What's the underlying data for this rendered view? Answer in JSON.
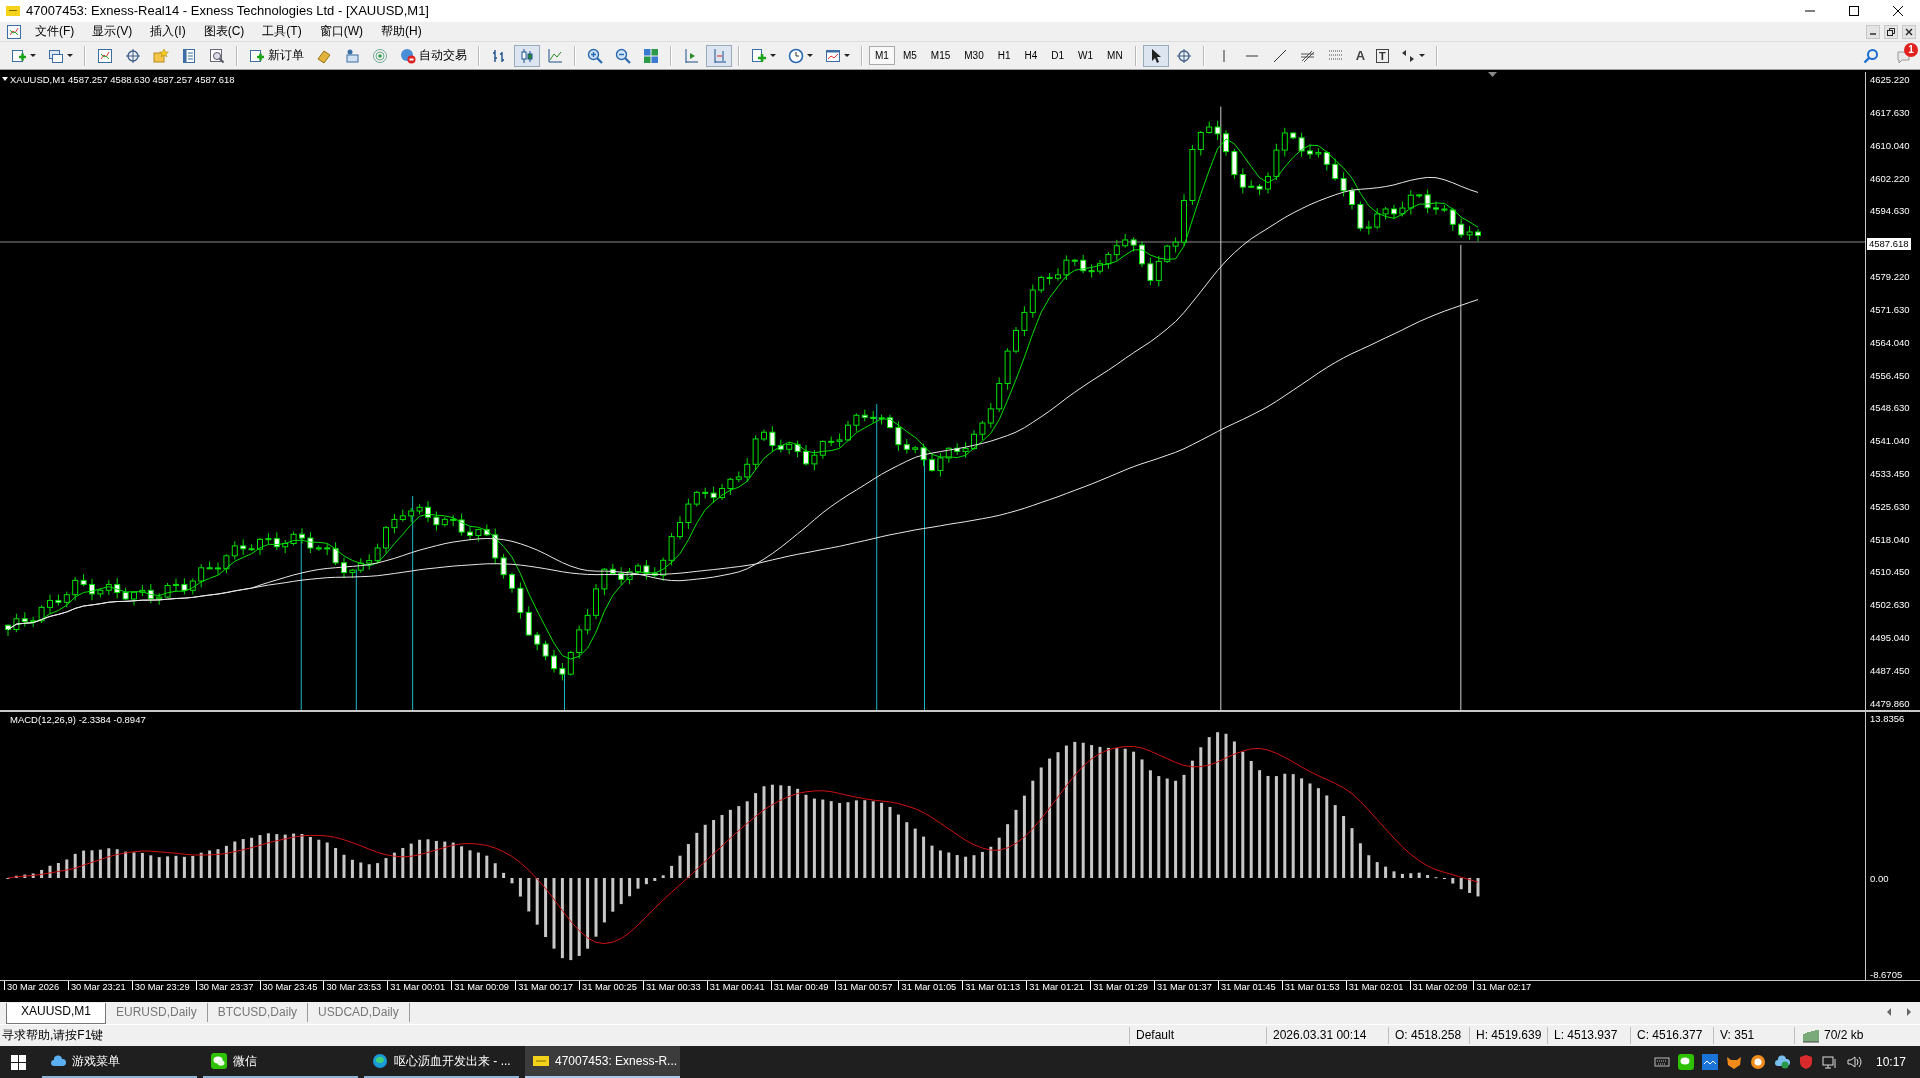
{
  "window": {
    "title": "47007453: Exness-Real14 - Exness Technologies Ltd - [XAUUSD,M1]"
  },
  "menu": [
    "文件(F)",
    "显示(V)",
    "插入(I)",
    "图表(C)",
    "工具(T)",
    "窗口(W)",
    "帮助(H)"
  ],
  "toolbar": {
    "new_order": "新订单",
    "auto_trading": "自动交易",
    "chart_types": [
      {
        "kind": "bar",
        "selected": false
      },
      {
        "kind": "candlestick",
        "selected": true
      },
      {
        "kind": "line",
        "selected": false
      }
    ],
    "scroll_buttons": [
      {
        "kind": "shift",
        "on": false
      },
      {
        "kind": "autoscroll",
        "on": true
      }
    ],
    "timeframes": [
      {
        "label": "M1",
        "selected": true
      },
      {
        "label": "M5",
        "selected": false
      },
      {
        "label": "M15",
        "selected": false
      },
      {
        "label": "M30",
        "selected": false
      },
      {
        "label": "H1",
        "selected": false
      },
      {
        "label": "H4",
        "selected": false
      },
      {
        "label": "D1",
        "selected": false
      },
      {
        "label": "W1",
        "selected": false
      },
      {
        "label": "MN",
        "selected": false
      }
    ],
    "cursor_tools": [
      {
        "kind": "arrow",
        "selected": true
      },
      {
        "kind": "crosshair",
        "selected": false
      }
    ],
    "text_tool": "A",
    "label_tool": "T",
    "notifications": "1"
  },
  "chart": {
    "info": "XAUUSD,M1 4587.257 4588.630 4587.257 4587.618",
    "price_axis": [
      "4625.220",
      "4617.630",
      "4610.040",
      "4602.220",
      "4594.630",
      "4579.220",
      "4571.630",
      "4564.040",
      "4556.450",
      "4548.630",
      "4541.040",
      "4533.450",
      "4525.630",
      "4518.040",
      "4510.450",
      "4502.630",
      "4495.040",
      "4487.450",
      "4479.860"
    ],
    "current_price": "4587.618",
    "macd": {
      "info": "MACD(12,26,9) -2.3384 -0.8947",
      "axis": [
        "13.8356",
        "0.00",
        "-8.6705"
      ]
    },
    "time_axis": [
      "30 Mar 2026",
      "30 Mar 23:21",
      "30 Mar 23:29",
      "30 Mar 23:37",
      "30 Mar 23:45",
      "30 Mar 23:53",
      "31 Mar 00:01",
      "31 Mar 00:09",
      "31 Mar 00:17",
      "31 Mar 00:25",
      "31 Mar 00:33",
      "31 Mar 00:41",
      "31 Mar 00:49",
      "31 Mar 00:57",
      "31 Mar 01:05",
      "31 Mar 01:13",
      "31 Mar 01:21",
      "31 Mar 01:29",
      "31 Mar 01:37",
      "31 Mar 01:45",
      "31 Mar 01:53",
      "31 Mar 02:01",
      "31 Mar 02:09",
      "31 Mar 02:17"
    ]
  },
  "tabs": [
    {
      "label": "XAUUSD,M1",
      "selected": true
    },
    {
      "label": "EURUSD,Daily",
      "selected": false
    },
    {
      "label": "BTCUSD,Daily",
      "selected": false
    },
    {
      "label": "USDCAD,Daily",
      "selected": false
    }
  ],
  "status_bar": {
    "help": "寻求帮助,请按F1键",
    "profile": "Default",
    "time": "2026.03.31 00:14",
    "open": "O: 4518.258",
    "high": "H: 4519.639",
    "low": "L: 4513.937",
    "close": "C: 4516.377",
    "volume": "V: 351",
    "traffic": "70/2 kb"
  },
  "taskbar": {
    "items": [
      {
        "label": "游戏菜单",
        "kind": "cloud",
        "selected": false
      },
      {
        "label": "微信",
        "kind": "chat",
        "selected": false
      },
      {
        "label": "呕心沥血开发出来 - ...",
        "kind": "browser",
        "selected": false
      },
      {
        "label": "47007453: Exness-R...",
        "kind": "exness",
        "selected": true
      }
    ],
    "clock": "10:17"
  }
}
